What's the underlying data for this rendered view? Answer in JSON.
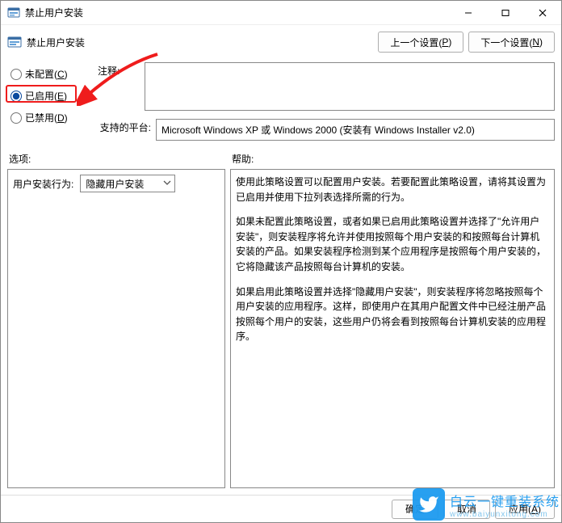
{
  "window": {
    "title": "禁止用户安装"
  },
  "header": {
    "title": "禁止用户安装"
  },
  "nav": {
    "prev_pre": "上一个设置(",
    "prev_u": "P",
    "prev_post": ")",
    "next_pre": "下一个设置(",
    "next_u": "N",
    "next_post": ")"
  },
  "radios": {
    "not_configured_pre": "未配置(",
    "not_configured_u": "C",
    "not_configured_post": ")",
    "enabled_pre": "已启用(",
    "enabled_u": "E",
    "enabled_post": ")",
    "disabled_pre": "已禁用(",
    "disabled_u": "D",
    "disabled_post": ")",
    "selected": "enabled"
  },
  "fields": {
    "comment_label": "注释:",
    "comment_value": "",
    "platform_label": "支持的平台:",
    "platform_value": "Microsoft Windows XP 或 Windows 2000 (安装有 Windows Installer v2.0)"
  },
  "sections": {
    "options_label": "选项:",
    "help_label": "帮助:"
  },
  "options": {
    "behavior_label": "用户安装行为:",
    "behavior_value": "隐藏用户安装"
  },
  "help": {
    "p1": "使用此策略设置可以配置用户安装。若要配置此策略设置，请将其设置为已启用并使用下拉列表选择所需的行为。",
    "p2": "如果未配置此策略设置，或者如果已启用此策略设置并选择了\"允许用户安装\"，则安装程序将允许并使用按照每个用户安装的和按照每台计算机安装的产品。如果安装程序检测到某个应用程序是按照每个用户安装的，它将隐藏该产品按照每台计算机的安装。",
    "p3": "如果启用此策略设置并选择\"隐藏用户安装\"，则安装程序将忽略按照每个用户安装的应用程序。这样，即使用户在其用户配置文件中已经注册产品按照每个用户的安装，这些用户仍将会看到按照每台计算机安装的应用程序。"
  },
  "footer": {
    "ok": "确定",
    "cancel": "取消",
    "apply_pre": "应用(",
    "apply_u": "A",
    "apply_post": ")"
  },
  "watermark": {
    "line1": "白云一键重装系统",
    "line2": "www.baiyunxitong.com"
  }
}
